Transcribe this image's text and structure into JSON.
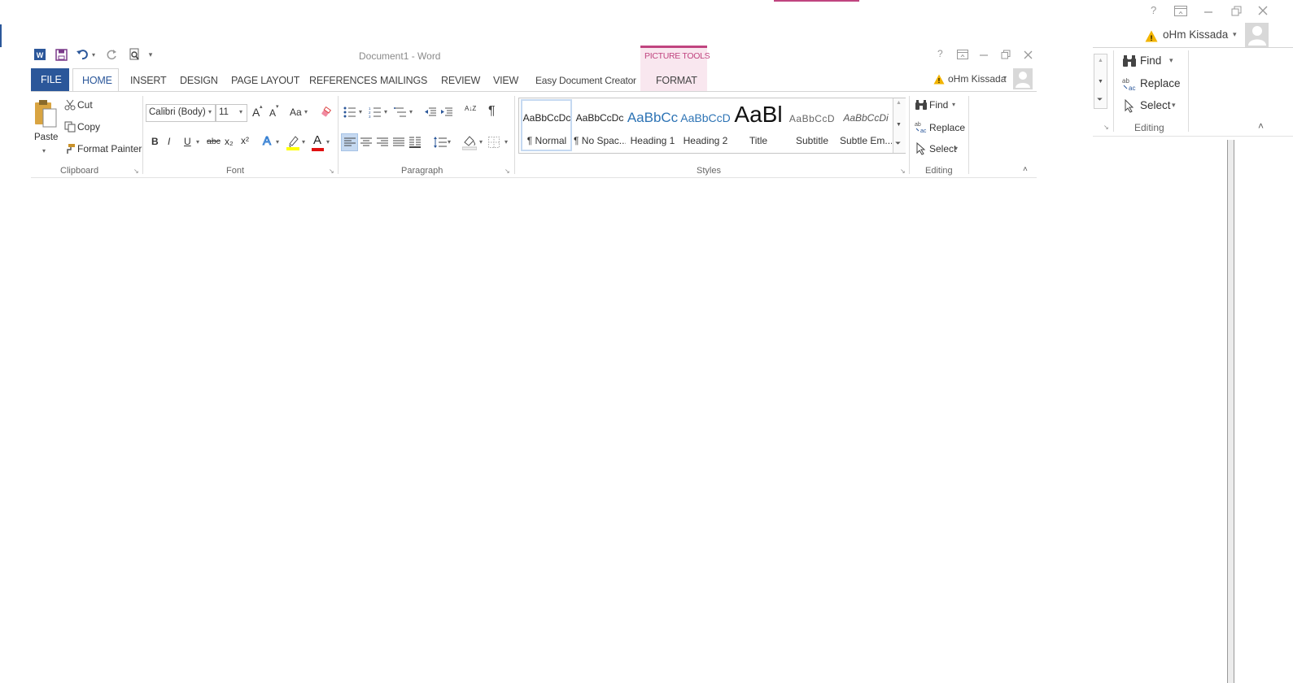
{
  "window": {
    "title": "Document1 - Word",
    "contextual_tab_group": "PICTURE TOOLS",
    "help_glyph": "?",
    "user_name": "oHm Kissada"
  },
  "qat": {
    "customize_glyph": "▾"
  },
  "tabs": [
    {
      "label": "FILE"
    },
    {
      "label": "HOME"
    },
    {
      "label": "INSERT"
    },
    {
      "label": "DESIGN"
    },
    {
      "label": "PAGE LAYOUT"
    },
    {
      "label": "REFERENCES"
    },
    {
      "label": "MAILINGS"
    },
    {
      "label": "REVIEW"
    },
    {
      "label": "VIEW"
    },
    {
      "label": "Easy Document Creator"
    },
    {
      "label": "FORMAT"
    }
  ],
  "clipboard": {
    "paste": "Paste",
    "cut": "Cut",
    "copy": "Copy",
    "format_painter": "Format Painter",
    "group_label": "Clipboard"
  },
  "font": {
    "font_name": "Calibri (Body)",
    "font_size": "11",
    "bold": "B",
    "italic": "I",
    "underline": "U",
    "strike": "abc",
    "subscript": "x₂",
    "superscript": "x²",
    "text_effects": "A",
    "font_color": "A",
    "change_case": "Aa",
    "grow": "A",
    "shrink": "A",
    "group_label": "Font"
  },
  "paragraph": {
    "sort": "A↓Z",
    "show_marks": "¶",
    "group_label": "Paragraph"
  },
  "styles": {
    "items": [
      {
        "sample": "AaBbCcDc",
        "name": "¶ Normal"
      },
      {
        "sample": "AaBbCcDc",
        "name": "¶ No Spac..."
      },
      {
        "sample": "AaBbCc",
        "name": "Heading 1"
      },
      {
        "sample": "AaBbCcD",
        "name": "Heading 2"
      },
      {
        "sample": "AaBl",
        "name": "Title"
      },
      {
        "sample": "AaBbCcD",
        "name": "Subtitle"
      },
      {
        "sample": "AaBbCcDi",
        "name": "Subtle Em..."
      }
    ],
    "group_label": "Styles"
  },
  "editing": {
    "find": "Find",
    "replace": "Replace",
    "select": "Select",
    "group_label": "Editing"
  },
  "colors": {
    "file_tab": "#2b579a",
    "contextual": "#c0447f",
    "contextual_bg": "#f9e7ef",
    "accent_text": "#2b579a"
  }
}
